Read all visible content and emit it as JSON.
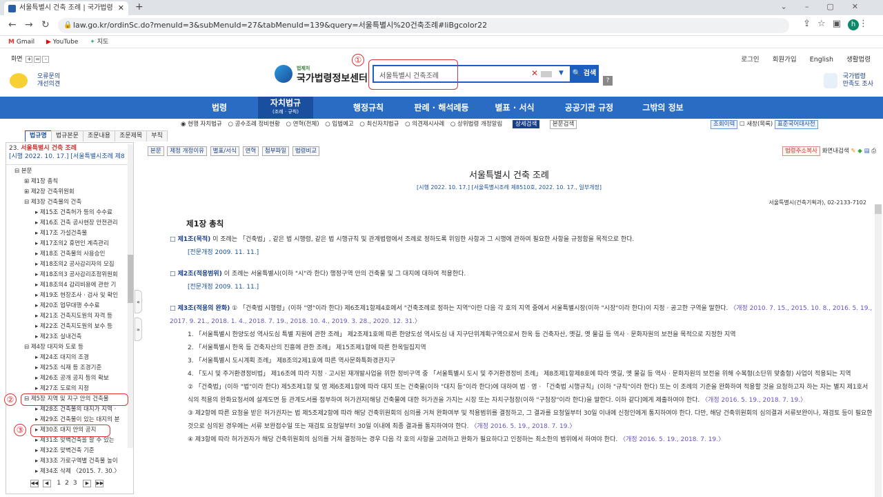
{
  "browser": {
    "tab_title": "서울특별시 건축 조례 | 국가법령",
    "url": "law.go.kr/ordinSc.do?menuId=3&subMenuId=27&tabMenuId=139&query=서울특별시%20건축조례#liBgcolor22",
    "bookmarks": [
      "Gmail",
      "YouTube",
      "지도"
    ],
    "avatar_letter": "h"
  },
  "header": {
    "zoom_label": "화면",
    "feedback": [
      "오류문의",
      "개선의견"
    ],
    "logo_small": "법제처",
    "logo_big": "국가법령정보센터",
    "search_value": "서울특별시 건축조례",
    "search_button": "검색",
    "help": "?",
    "util": [
      "로그인",
      "회원가입",
      "English",
      "생활법령"
    ],
    "survey": [
      "국가법령",
      "만족도 조사"
    ]
  },
  "annotations": [
    "①",
    "②",
    "③"
  ],
  "mainnav": [
    {
      "label": "법령"
    },
    {
      "label": "자치법규",
      "sub": "(조례 · 규칙)"
    },
    {
      "label": "행정규칙"
    },
    {
      "label": "판례 · 해석례등"
    },
    {
      "label": "별표 · 서식"
    },
    {
      "label": "공공기관 규정"
    },
    {
      "label": "그밖의 정보"
    }
  ],
  "filter": {
    "options": [
      "◉ 현행 자치법규",
      "○ 공수조례 정비현황",
      "○ 연혁(전체)",
      "○ 입법예고",
      "○ 최신자치법규",
      "○ 의견제시사례",
      "○ 상위법령 개정알림"
    ],
    "detail_search": "상세검색",
    "main_search": "본문검색",
    "history": "조회이력",
    "checkbox": "새창(목록)",
    "dictionary": "표준국어대사전"
  },
  "left": {
    "tabs": [
      "법규명",
      "법규본문",
      "조문내용",
      "조문제목",
      "부칙"
    ],
    "head_num": "23.",
    "head_title": "서울특별시 건축 조례",
    "head_sub": "[시행 2022. 10. 17.] [서울특별시조례 제8",
    "tree": [
      {
        "lvl": 0,
        "text": "⊟ 본문"
      },
      {
        "lvl": 1,
        "text": "⊞ 제1장 총칙"
      },
      {
        "lvl": 1,
        "text": "⊞ 제2장 건축위원회"
      },
      {
        "lvl": 1,
        "text": "⊟ 제3장 건축물의 건축"
      },
      {
        "lvl": 2,
        "text": "▸ 제15조 건축허가 등의 수수료"
      },
      {
        "lvl": 2,
        "text": "▸ 제16조 건축 공사현장 안전관리"
      },
      {
        "lvl": 2,
        "text": "▸ 제17조 가설건축물"
      },
      {
        "lvl": 2,
        "text": "▸ 제17조의2 휴먼인 계측관리"
      },
      {
        "lvl": 2,
        "text": "▸ 제18조 건축물의 사용승인"
      },
      {
        "lvl": 2,
        "text": "▸ 제18조의2 공사감리자의 모집"
      },
      {
        "lvl": 2,
        "text": "▸ 제18조의3 공사감리조정위원회"
      },
      {
        "lvl": 2,
        "text": "▸ 제18조의4 감리비용에 관한 기"
      },
      {
        "lvl": 2,
        "text": "▸ 제19조 현장조사 · 검사 및 확인"
      },
      {
        "lvl": 2,
        "text": "▸ 제20조 업무대행 수수료"
      },
      {
        "lvl": 2,
        "text": "▸ 제21조 건축지도원의 자격 등"
      },
      {
        "lvl": 2,
        "text": "▸ 제22조 건축지도원의 보수 등"
      },
      {
        "lvl": 2,
        "text": "▸ 제23조 실내건축"
      },
      {
        "lvl": 1,
        "text": "⊟ 제4장 대지와 도로 등"
      },
      {
        "lvl": 2,
        "text": "▸ 제24조 대지의 조경"
      },
      {
        "lvl": 2,
        "text": "▸ 제25조 식재 등 조경기준"
      },
      {
        "lvl": 2,
        "text": "▸ 제26조 공개 공지 등의 확보"
      },
      {
        "lvl": 2,
        "text": "▸ 제27조 도로의 지정"
      },
      {
        "lvl": 1,
        "text": "⊟ 제5장 지역 및 지구 안의 건축물"
      },
      {
        "lvl": 2,
        "text": "▸ 제28조 건축물의 대지가 지역 ·"
      },
      {
        "lvl": 2,
        "text": "▸ 제29조 건축물이 있는 대지의 분"
      },
      {
        "lvl": 2,
        "text": "▸ 제30조 대지 안의 공지"
      },
      {
        "lvl": 2,
        "text": "▸ 제31조 맞벽건축을 할 수 있는"
      },
      {
        "lvl": 2,
        "text": "▸ 제32조 맞벽건축 기준"
      },
      {
        "lvl": 2,
        "text": "▸ 제33조 가로구역별 건축물 높이"
      },
      {
        "lvl": 2,
        "text": "▸ 제34조 삭제 〈2015. 7. 30.〉"
      }
    ],
    "pager": [
      "1",
      "2",
      "3"
    ]
  },
  "toolbar": {
    "buttons": [
      "본문",
      "제정 개정이유",
      "별표/서식",
      "연혁",
      "첨부파일",
      "법령비교"
    ],
    "right": [
      "법령주소복사",
      "화면내검색"
    ]
  },
  "doc": {
    "title": "서울특별시 건축 조례",
    "subtitle": "[시행 2022. 10. 17.] [서울특별시조례 제8510호, 2022. 10. 17., 일부개정]",
    "dept": "서울특별시(건축기획과), 02-2133-7102",
    "chapter": "제1장 총칙",
    "a1_head": "□ 제1조(목적)",
    "a1_body": "이 조례는 「건축법」, 같은 법 시행령, 같은 법 시행규칙 및 관계법령에서 조례로 정하도록 위임한 사항과 그 시행에 관하여 필요한 사항을 규정함을 목적으로 한다.",
    "a1_rev": "[전문개정 2009. 11. 11.]",
    "a2_head": "□ 제2조(적용범위)",
    "a2_body": "이 조례는 서울특별시(이하 \"시\"라 한다) 행정구역 안의 건축물 및 그 대지에 대하여 적용한다.",
    "a2_rev": "[전문개정 2009. 11. 11.]",
    "a3_head": "□ 제3조(적용의 완화)",
    "a3_p1": "① 「건축법 시행령」(이하 \"영\"이라 한다) 제6조제1항제4호에서 \"건축조례로 정하는 지역\"이란 다음 각 호의 지역 중에서 서울특별시장(이하 \"시장\"이라 한다)이 지정 · 공고한 구역을 말한다.",
    "a3_p1_rev": "〈개정 2010. 7. 15., 2015. 10. 8., 2016. 5. 19., 2017. 9. 21., 2018. 1. 4., 2018. 7. 19., 2018. 10. 4., 2019. 3. 28., 2020. 12. 31.〉",
    "a3_items": [
      "1. 「서울특별시 한양도성 역사도심 특별 지원에 관한 조례」 제2조제1호에 따른 한양도성 역사도심 내 지구단위계획구역으로서 한옥 등 건축자산, 옛길, 옛 물길 등 역사 · 문화자원의 보전을 목적으로 지정한 지역",
      "2. 「서울특별시 한옥 등 건축자산의 진흥에 관한 조례」 제15조제1항에 따른 한옥밀집지역",
      "3. 「서울특별시 도시계획 조례」 제8조의2제1호에 따른 역사문화특화경관지구",
      "4. 「도시 및 주거환경정비법」 제16조에 따라 지정 · 고시된 재개발사업을 위한 정비구역 중 「서울특별시 도시 및 주거환경정비 조례」 제8조제1항제8호에 따라 옛길, 옛 물길 등 역사 · 문화자원의 보전을 위해 수복형(소단위 맞춤형) 사업이 적용되는 지역"
    ],
    "a3_p2": "② 「건축법」(이하 \"법\"이라 한다) 제5조제1항 및 영 제6조제1항에 따라 대지 또는 건축물(이하 \"대지 등\"이라 한다)에 대하여 법 · 영 · 「건축법 시행규칙」(이하 \"규칙\"이라 한다) 또는 이 조례의 기준을 완화하여 적용할 것을 요청하고자 하는 자는 별지 제1호서식의 적용의 완화요청서에 설계도면 등 관계도서를 첨부하여 허가권자[해당 건축물에 대한 허가권을 가지는 시장 또는 자치구청장(이하 \"구청장\"이라 한다)을 말한다. 이하 같다]에게 제출하여야 한다.",
    "a3_p2_rev": "〈개정 2016. 5. 19., 2018. 7. 19.〉",
    "a3_p3": "③ 제2항에 따른 요청을 받은 허가권자는 법 제5조제2항에 따라 해당 건축위원회의 심의를 거쳐 완화여부 및 적용범위를 결정하고, 그 결과를 요청일부터 30일 이내에 신청인에게 통지하여야 한다. 다만, 해당 건축위원회의 심의결과 서류보완이나, 재검토 등이 필요한 것으로 심의된 경우에는 서류 보완접수일 또는 재검토 요청일부터 30일 이내에 최종 결과를 통지하여야 한다.",
    "a3_p3_rev": "〈개정 2016. 5. 19., 2018. 7. 19.〉",
    "a3_p4": "④ 제3항에 따라 허가권자가 해당 건축위원회의 심의를 거쳐 결정하는 경우 다음 각 호의 사항을 고려하고 완화가 필요하다고 인정하는 최소한의 범위에서 하여야 한다.",
    "a3_p4_rev": "〈개정 2016. 5. 19., 2018. 7. 19.〉"
  }
}
